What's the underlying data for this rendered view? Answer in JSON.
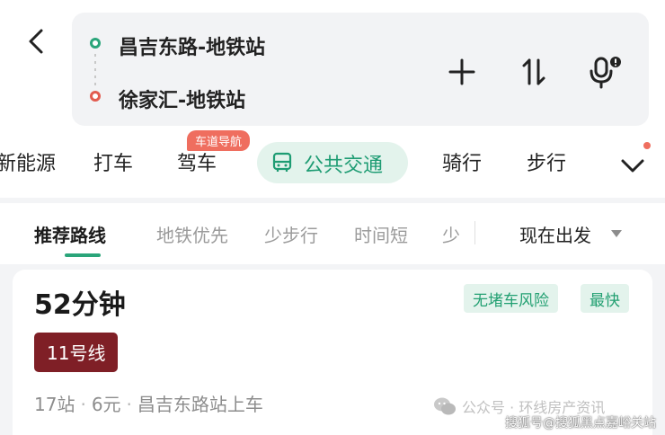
{
  "route": {
    "from": "昌吉东路-地铁站",
    "to": "徐家汇-地铁站",
    "colors": {
      "from": "#2aa57a",
      "to": "#e25b4f"
    }
  },
  "tools": [
    "add-icon",
    "swap-icon",
    "voice-icon"
  ],
  "modes": {
    "items": [
      "新能源",
      "打车",
      "驾车",
      "公共交通",
      "骑行",
      "步行"
    ],
    "active": "公共交通",
    "drive_badge": "车道导航"
  },
  "filters": {
    "items": [
      "推荐路线",
      "地铁优先",
      "少步行",
      "时间短",
      "少"
    ],
    "selected": "推荐路线",
    "departure": "现在出发"
  },
  "card": {
    "duration": "52分钟",
    "tags": [
      "无堵车风险",
      "最快"
    ],
    "line": "11号线",
    "line_color": "#7f1f26",
    "stops": "17站",
    "fare": "6元",
    "boarding": "昌吉东路站上车"
  },
  "watermarks": {
    "wechat": "公众号 · 环线房产资讯",
    "sohu": "搜狐号@搜狐黑点嘉峪关站"
  },
  "accent": "#2aa57a"
}
